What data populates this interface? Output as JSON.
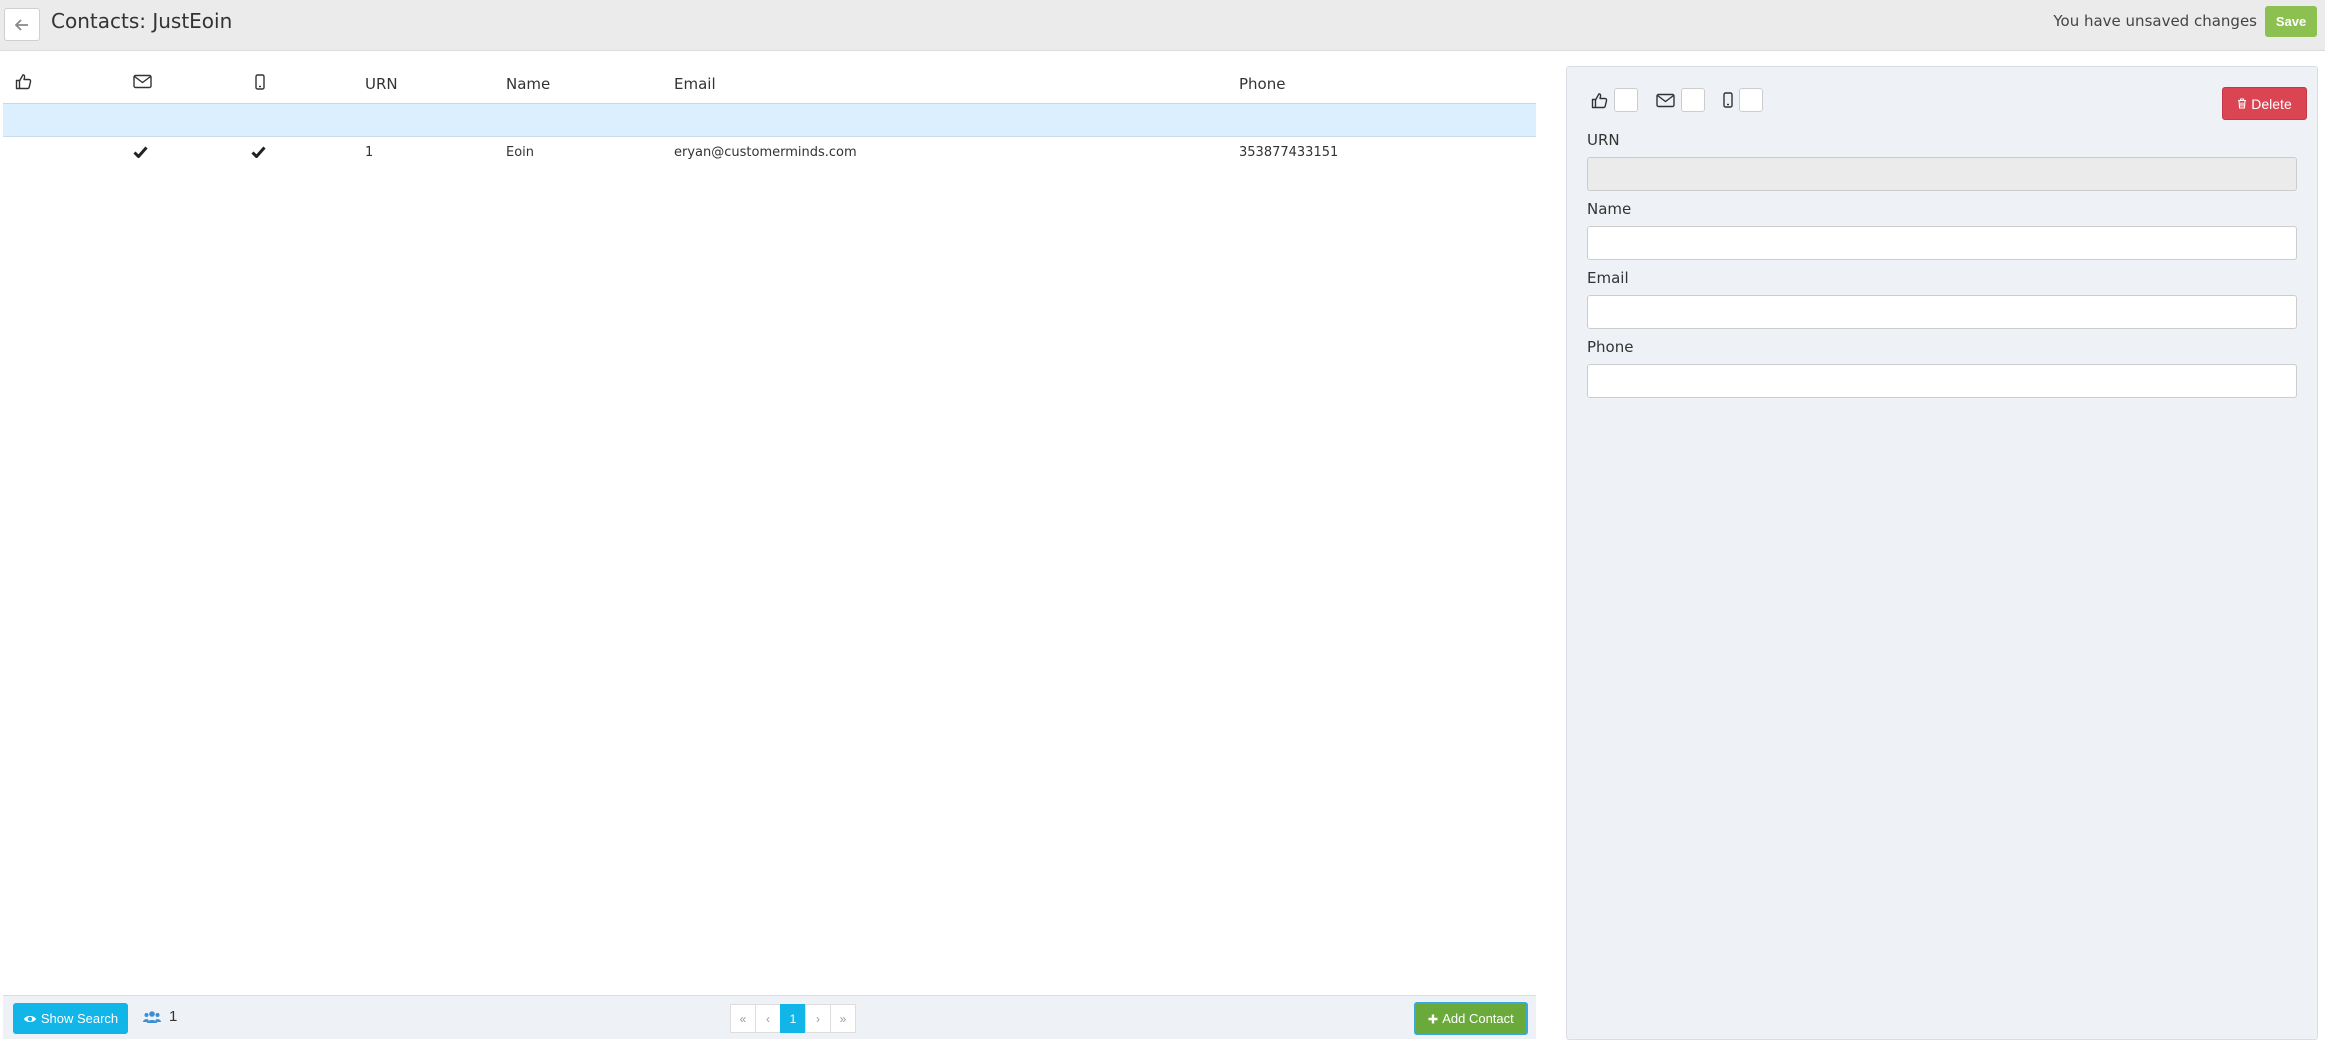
{
  "header": {
    "title": "Contacts: JustEoin",
    "unsaved_text": "You have unsaved changes",
    "save_label": "Save"
  },
  "table": {
    "columns": [
      "URN",
      "Name",
      "Email",
      "Phone"
    ],
    "rows": [
      {
        "consent": false,
        "email_opt": true,
        "sms_opt": true,
        "urn": "1",
        "name": "Eoin",
        "email": "eryan@customerminds.com",
        "phone": "353877433151"
      }
    ]
  },
  "footer": {
    "show_search_label": "Show Search",
    "count": "1",
    "pager": {
      "first": "«",
      "prev": "‹",
      "current": "1",
      "next": "›",
      "last": "»"
    },
    "add_contact_label": "Add Contact"
  },
  "panel": {
    "delete_label": "Delete",
    "fields": {
      "urn": {
        "label": "URN",
        "value": ""
      },
      "name": {
        "label": "Name",
        "value": ""
      },
      "email": {
        "label": "Email",
        "value": ""
      },
      "phone": {
        "label": "Phone",
        "value": ""
      }
    }
  },
  "colors": {
    "primary": "#11b5e8",
    "save_green": "#8cc152",
    "add_green": "#6aaa3a",
    "danger": "#da4453",
    "selected_row": "#dcefff",
    "panel_bg": "#eef2f6"
  },
  "icons": [
    "arrow-left-icon",
    "thumbs-up-icon",
    "envelope-icon",
    "mobile-icon",
    "check-icon",
    "eye-icon",
    "users-icon",
    "plus-icon",
    "trash-icon"
  ]
}
